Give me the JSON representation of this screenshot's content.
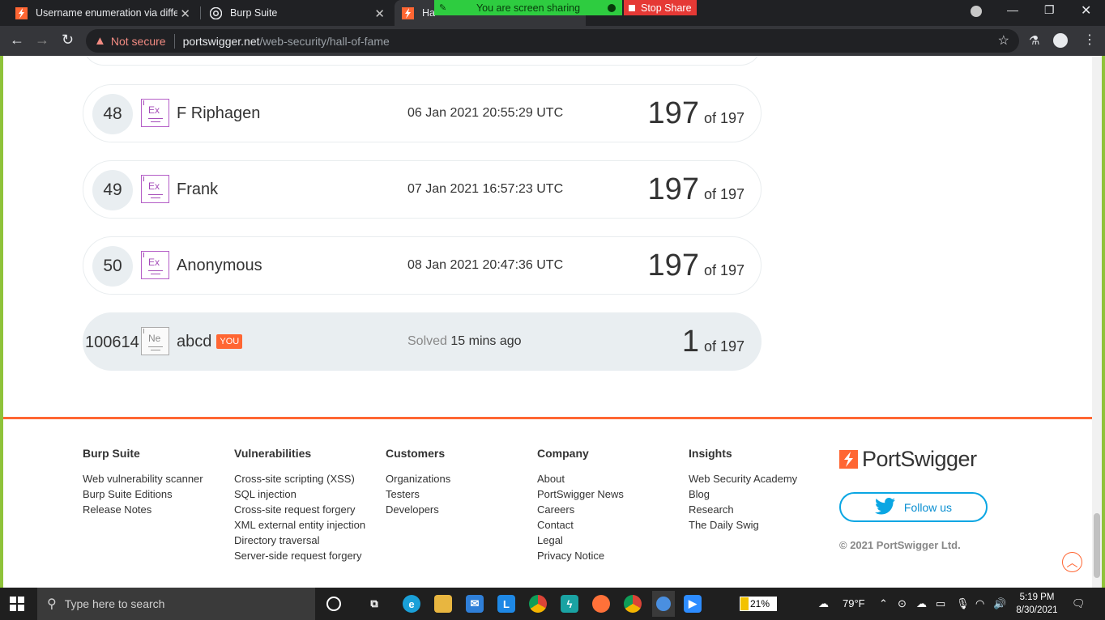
{
  "browser": {
    "tabs": [
      {
        "title": "Username enumeration via differ"
      },
      {
        "title": "Burp Suite"
      },
      {
        "title": "Ha"
      }
    ],
    "screen_share": {
      "status": "You are screen sharing",
      "stop_label": "Stop Share"
    },
    "address": {
      "security": "Not secure",
      "host": "portswigger.net",
      "path": "/web-security/hall-of-fame"
    }
  },
  "leaderboard": {
    "of_label": "of 197",
    "rows": [
      {
        "rank": "48",
        "level": "Ex",
        "name": "F Riphagen",
        "date": "06 Jan 2021 20:55:29 UTC",
        "score": "197"
      },
      {
        "rank": "49",
        "level": "Ex",
        "name": "Frank",
        "date": "07 Jan 2021 16:57:23 UTC",
        "score": "197"
      },
      {
        "rank": "50",
        "level": "Ex",
        "name": "Anonymous",
        "date": "08 Jan 2021 20:47:36 UTC",
        "score": "197"
      }
    ],
    "you_row": {
      "rank": "100614",
      "level": "Ne",
      "name": "abcd",
      "badge": "YOU",
      "solved_label": "Solved",
      "solved_when": "15 mins ago",
      "score": "1"
    }
  },
  "footer": {
    "columns": [
      {
        "heading": "Burp Suite",
        "links": [
          "Web vulnerability scanner",
          "Burp Suite Editions",
          "Release Notes"
        ]
      },
      {
        "heading": "Vulnerabilities",
        "links": [
          "Cross-site scripting (XSS)",
          "SQL injection",
          "Cross-site request forgery",
          "XML external entity injection",
          "Directory traversal",
          "Server-side request forgery"
        ]
      },
      {
        "heading": "Customers",
        "links": [
          "Organizations",
          "Testers",
          "Developers"
        ]
      },
      {
        "heading": "Company",
        "links": [
          "About",
          "PortSwigger News",
          "Careers",
          "Contact",
          "Legal",
          "Privacy Notice"
        ]
      },
      {
        "heading": "Insights",
        "links": [
          "Web Security Academy",
          "Blog",
          "Research",
          "The Daily Swig"
        ]
      }
    ],
    "brand": "PortSwigger",
    "follow_label": "Follow us",
    "copyright": "© 2021 PortSwigger Ltd."
  },
  "taskbar": {
    "search_placeholder": "Type here to search",
    "battery": "21%",
    "temperature": "79°F",
    "time": "5:19 PM",
    "date": "8/30/2021"
  },
  "colors": {
    "accent": "#ff6633",
    "expert_level": "#a44bb8",
    "twitter": "#0aa6e3",
    "share_green": "#2ecc40",
    "share_red": "#e53935"
  }
}
